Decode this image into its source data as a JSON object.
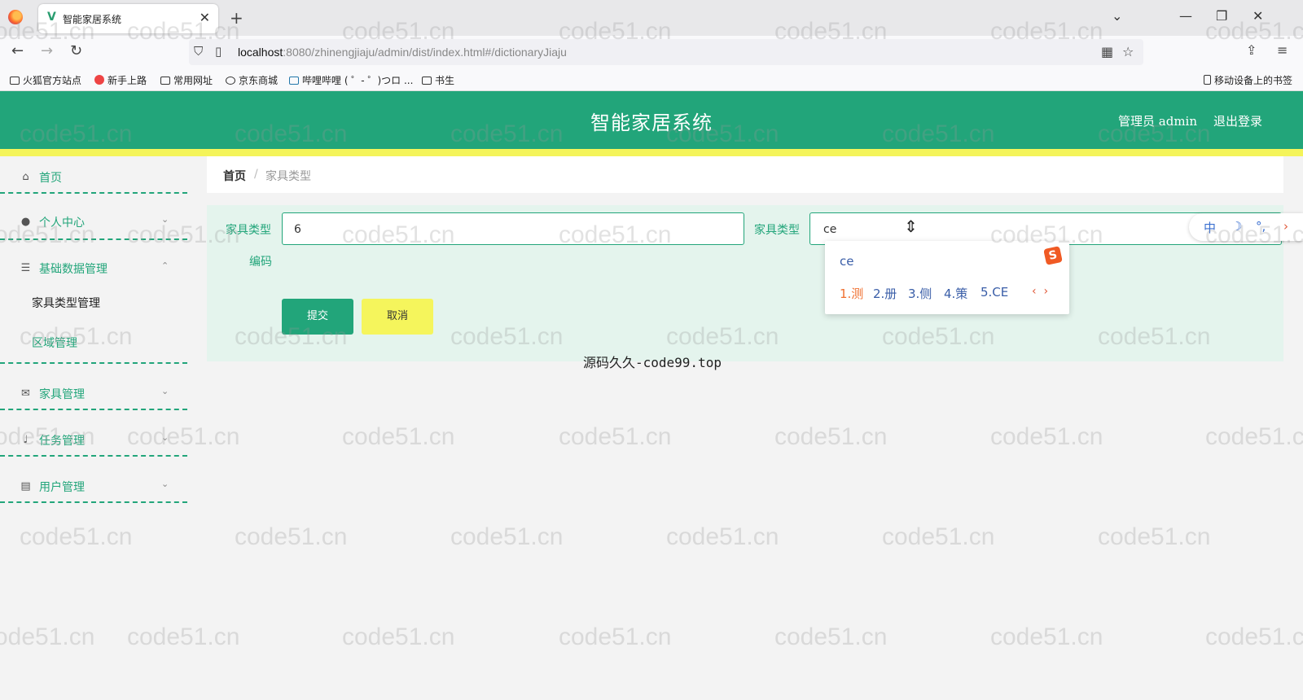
{
  "browser": {
    "tab_title": "智能家居系统",
    "tab_close": "✕",
    "new_tab": "+",
    "url_host": "localhost",
    "url_path": ":8080/zhinengjiaju/admin/dist/index.html#/dictionaryJiaju",
    "bookmarks": [
      "火狐官方站点",
      "新手上路",
      "常用网址",
      "京东商城",
      "哔哩哔哩 ( ゜- ゜)つロ ...",
      "书生"
    ],
    "mobile_bookmarks": "移动设备上的书签"
  },
  "header": {
    "title": "智能家居系统",
    "user": "管理员 admin",
    "logout": "退出登录"
  },
  "sidebar": {
    "items": [
      {
        "label": "首页"
      },
      {
        "label": "个人中心"
      },
      {
        "label": "基础数据管理"
      },
      {
        "label": "家具管理"
      },
      {
        "label": "任务管理"
      },
      {
        "label": "用户管理"
      }
    ],
    "sub_items": [
      {
        "label": "家具类型管理",
        "active": true
      },
      {
        "label": "区域管理",
        "active": false
      }
    ]
  },
  "breadcrumb": {
    "home": "首页",
    "separator": "/",
    "current": "家具类型"
  },
  "form": {
    "code_label_line1": "家具类型",
    "code_label_line2": "编码",
    "code_value": "6",
    "name_label": "家具类型",
    "name_value": "ce",
    "submit": "提交",
    "cancel": "取消"
  },
  "ime": {
    "composition": "ce",
    "candidates": [
      "1.测",
      "2.册",
      "3.侧",
      "4.策",
      "5.CE"
    ],
    "prev": "‹",
    "next": "›",
    "bar": [
      "中",
      "☽",
      "°,",
      "›"
    ]
  },
  "caption": "源码久久-code99.top",
  "watermark": "code51.cn",
  "colors": {
    "primary": "#22a57a",
    "accent_yellow": "#f4f45a",
    "panel_bg": "#e4f4ed"
  }
}
